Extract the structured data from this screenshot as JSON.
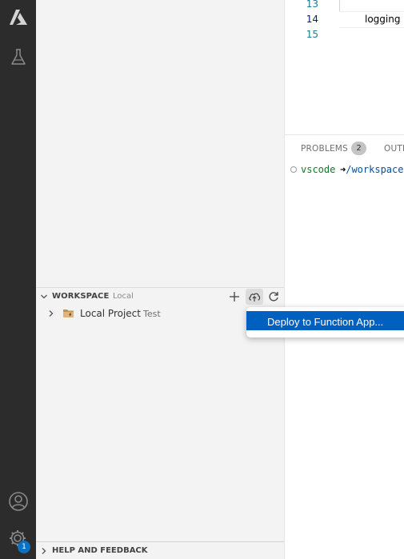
{
  "activity_bar": {
    "items": [
      {
        "icon": "azure-icon"
      },
      {
        "icon": "testing-flask-icon"
      },
      {
        "icon": "account-icon"
      },
      {
        "icon": "settings-gear-icon"
      }
    ],
    "settings_badge": "1"
  },
  "editor": {
    "lines": [
      {
        "number": "13",
        "code": ""
      },
      {
        "number": "14",
        "code": "logging"
      },
      {
        "number": "15",
        "code": ""
      }
    ]
  },
  "panel": {
    "tabs": [
      {
        "label": "PROBLEMS",
        "count": "2"
      },
      {
        "label": "OUTPUT"
      }
    ],
    "terminal": {
      "user": "vscode",
      "arrow": "➜",
      "path": "/workspace"
    }
  },
  "workspace": {
    "title": "WORKSPACE",
    "subtitle": "Local",
    "actions": [
      {
        "icon": "add-icon"
      },
      {
        "icon": "cloud-upload-icon"
      },
      {
        "icon": "refresh-icon"
      }
    ],
    "items": [
      {
        "label": "Local Project",
        "description": "Test",
        "icon": "function-folder-icon"
      }
    ]
  },
  "context_menu": {
    "items": [
      {
        "label": "Deploy to Function App..."
      }
    ]
  },
  "help_section": {
    "title": "HELP AND FEEDBACK"
  },
  "colors": {
    "activity_bar": "#2c2c2c",
    "sidebar": "#f3f3f3",
    "menu_highlight": "#0060c0",
    "badge": "#0e70c0"
  }
}
